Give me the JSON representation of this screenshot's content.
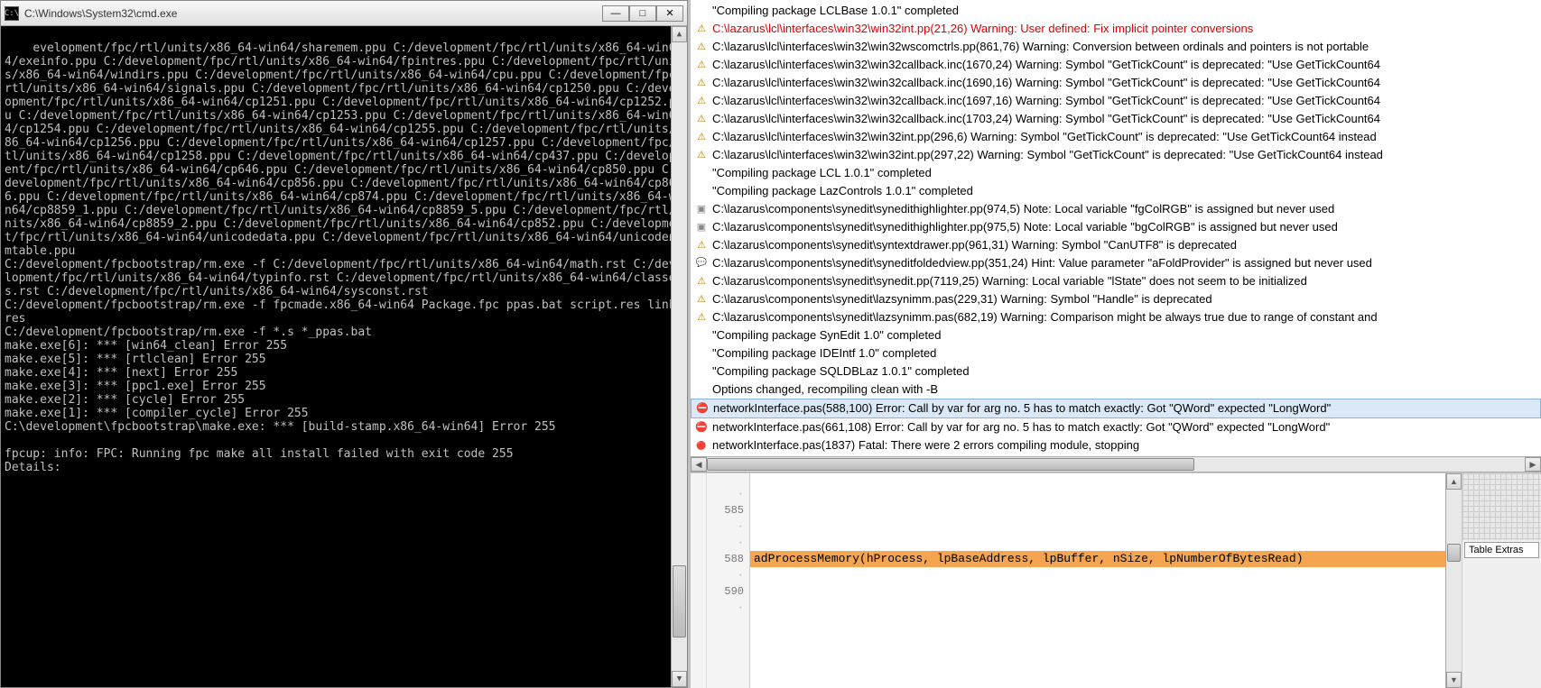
{
  "cmd": {
    "title": "C:\\Windows\\System32\\cmd.exe",
    "icon_label": "C:\\",
    "minimize": "—",
    "maximize": "□",
    "close": "✕",
    "scroll_up": "▲",
    "scroll_down": "▼",
    "body_text": "evelopment/fpc/rtl/units/x86_64-win64/sharemem.ppu C:/development/fpc/rtl/units/x86_64-win64/exeinfo.ppu C:/development/fpc/rtl/units/x86_64-win64/fpintres.ppu C:/development/fpc/rtl/units/x86_64-win64/windirs.ppu C:/development/fpc/rtl/units/x86_64-win64/cpu.ppu C:/development/fpc/rtl/units/x86_64-win64/signals.ppu C:/development/fpc/rtl/units/x86_64-win64/cp1250.ppu C:/development/fpc/rtl/units/x86_64-win64/cp1251.ppu C:/development/fpc/rtl/units/x86_64-win64/cp1252.ppu C:/development/fpc/rtl/units/x86_64-win64/cp1253.ppu C:/development/fpc/rtl/units/x86_64-win64/cp1254.ppu C:/development/fpc/rtl/units/x86_64-win64/cp1255.ppu C:/development/fpc/rtl/units/x86_64-win64/cp1256.ppu C:/development/fpc/rtl/units/x86_64-win64/cp1257.ppu C:/development/fpc/rtl/units/x86_64-win64/cp1258.ppu C:/development/fpc/rtl/units/x86_64-win64/cp437.ppu C:/development/fpc/rtl/units/x86_64-win64/cp646.ppu C:/development/fpc/rtl/units/x86_64-win64/cp850.ppu C:/development/fpc/rtl/units/x86_64-win64/cp856.ppu C:/development/fpc/rtl/units/x86_64-win64/cp866.ppu C:/development/fpc/rtl/units/x86_64-win64/cp874.ppu C:/development/fpc/rtl/units/x86_64-win64/cp8859_1.ppu C:/development/fpc/rtl/units/x86_64-win64/cp8859_5.ppu C:/development/fpc/rtl/units/x86_64-win64/cp8859_2.ppu C:/development/fpc/rtl/units/x86_64-win64/cp852.ppu C:/development/fpc/rtl/units/x86_64-win64/unicodedata.ppu C:/development/fpc/rtl/units/x86_64-win64/unicodenumtable.ppu\nC:/development/fpcbootstrap/rm.exe -f C:/development/fpc/rtl/units/x86_64-win64/math.rst C:/development/fpc/rtl/units/x86_64-win64/typinfo.rst C:/development/fpc/rtl/units/x86_64-win64/classes.rst C:/development/fpc/rtl/units/x86_64-win64/sysconst.rst\nC:/development/fpcbootstrap/rm.exe -f fpcmade.x86_64-win64 Package.fpc ppas.bat script.res link.res\nC:/development/fpcbootstrap/rm.exe -f *.s *_ppas.bat\nmake.exe[6]: *** [win64_clean] Error 255\nmake.exe[5]: *** [rtlclean] Error 255\nmake.exe[4]: *** [next] Error 255\nmake.exe[3]: *** [ppc1.exe] Error 255\nmake.exe[2]: *** [cycle] Error 255\nmake.exe[1]: *** [compiler_cycle] Error 255\nC:\\development\\fpcbootstrap\\make.exe: *** [build-stamp.x86_64-win64] Error 255\n\nfpcup: info: FPC: Running fpc make all install failed with exit code 255\nDetails:"
  },
  "messages": [
    {
      "icon": "",
      "text": "\"Compiling package LCLBase 1.0.1\" completed"
    },
    {
      "icon": "warn",
      "red": true,
      "text": "C:\\lazarus\\lcl\\interfaces\\win32\\win32int.pp(21,26) Warning: User defined: Fix implicit pointer conversions"
    },
    {
      "icon": "warn",
      "text": "C:\\lazarus\\lcl\\interfaces\\win32\\win32wscomctrls.pp(861,76) Warning: Conversion between ordinals and pointers is not portable"
    },
    {
      "icon": "warn",
      "text": "C:\\lazarus\\lcl\\interfaces\\win32\\win32callback.inc(1670,24) Warning: Symbol \"GetTickCount\" is deprecated: \"Use GetTickCount64"
    },
    {
      "icon": "warn",
      "text": "C:\\lazarus\\lcl\\interfaces\\win32\\win32callback.inc(1690,16) Warning: Symbol \"GetTickCount\" is deprecated: \"Use GetTickCount64"
    },
    {
      "icon": "warn",
      "text": "C:\\lazarus\\lcl\\interfaces\\win32\\win32callback.inc(1697,16) Warning: Symbol \"GetTickCount\" is deprecated: \"Use GetTickCount64"
    },
    {
      "icon": "warn",
      "text": "C:\\lazarus\\lcl\\interfaces\\win32\\win32callback.inc(1703,24) Warning: Symbol \"GetTickCount\" is deprecated: \"Use GetTickCount64"
    },
    {
      "icon": "warn",
      "text": "C:\\lazarus\\lcl\\interfaces\\win32\\win32int.pp(296,6) Warning: Symbol \"GetTickCount\" is deprecated: \"Use GetTickCount64 instead"
    },
    {
      "icon": "warn",
      "text": "C:\\lazarus\\lcl\\interfaces\\win32\\win32int.pp(297,22) Warning: Symbol \"GetTickCount\" is deprecated: \"Use GetTickCount64 instead"
    },
    {
      "icon": "",
      "text": "\"Compiling package LCL 1.0.1\" completed"
    },
    {
      "icon": "",
      "text": "\"Compiling package LazControls 1.0.1\" completed"
    },
    {
      "icon": "note",
      "text": "C:\\lazarus\\components\\synedit\\synedithighlighter.pp(974,5) Note: Local variable \"fgColRGB\" is assigned but never used"
    },
    {
      "icon": "note",
      "text": "C:\\lazarus\\components\\synedit\\synedithighlighter.pp(975,5) Note: Local variable \"bgColRGB\" is assigned but never used"
    },
    {
      "icon": "warn",
      "text": "C:\\lazarus\\components\\synedit\\syntextdrawer.pp(961,31) Warning: Symbol \"CanUTF8\" is deprecated"
    },
    {
      "icon": "hint",
      "text": "C:\\lazarus\\components\\synedit\\syneditfoldedview.pp(351,24) Hint: Value parameter \"aFoldProvider\" is assigned but never used"
    },
    {
      "icon": "warn",
      "text": "C:\\lazarus\\components\\synedit\\synedit.pp(7119,25) Warning: Local variable \"lState\" does not seem to be initialized"
    },
    {
      "icon": "warn",
      "text": "C:\\lazarus\\components\\synedit\\lazsynimm.pas(229,31) Warning: Symbol \"Handle\" is deprecated"
    },
    {
      "icon": "warn",
      "text": "C:\\lazarus\\components\\synedit\\lazsynimm.pas(682,19) Warning: Comparison might be always true due to range of constant and"
    },
    {
      "icon": "",
      "text": "\"Compiling package SynEdit 1.0\" completed"
    },
    {
      "icon": "",
      "text": "\"Compiling package IDEIntf 1.0\" completed"
    },
    {
      "icon": "",
      "text": "\"Compiling package SQLDBLaz 1.0.1\" completed"
    },
    {
      "icon": "",
      "text": "Options changed, recompiling clean with -B"
    },
    {
      "icon": "err",
      "selected": true,
      "text": "networkInterface.pas(588,100) Error: Call by var for arg no. 5 has to match exactly: Got \"QWord\" expected \"LongWord\""
    },
    {
      "icon": "err",
      "text": "networkInterface.pas(661,108) Error: Call by var for arg no. 5 has to match exactly: Got \"QWord\" expected \"LongWord\""
    },
    {
      "icon": "fatal",
      "text": "networkInterface.pas(1837) Fatal: There were 2 errors compiling module, stopping"
    }
  ],
  "hscroll": {
    "left": "◀",
    "right": "▶"
  },
  "editor": {
    "lines": [
      {
        "num": "",
        "dot": true
      },
      {
        "num": "585"
      },
      {
        "num": "",
        "dot": true
      },
      {
        "num": "",
        "dot": true
      },
      {
        "num": "588",
        "code": "adProcessMemory(hProcess, lpBaseAddress, lpBuffer, nSize, lpNumberOfBytesRead)",
        "hl": true
      },
      {
        "num": "",
        "dot": true
      },
      {
        "num": "590"
      },
      {
        "num": "",
        "dot": true
      }
    ],
    "scroll_up": "▲",
    "scroll_down": "▼"
  },
  "extras": {
    "tab_label": "Table Extras"
  }
}
